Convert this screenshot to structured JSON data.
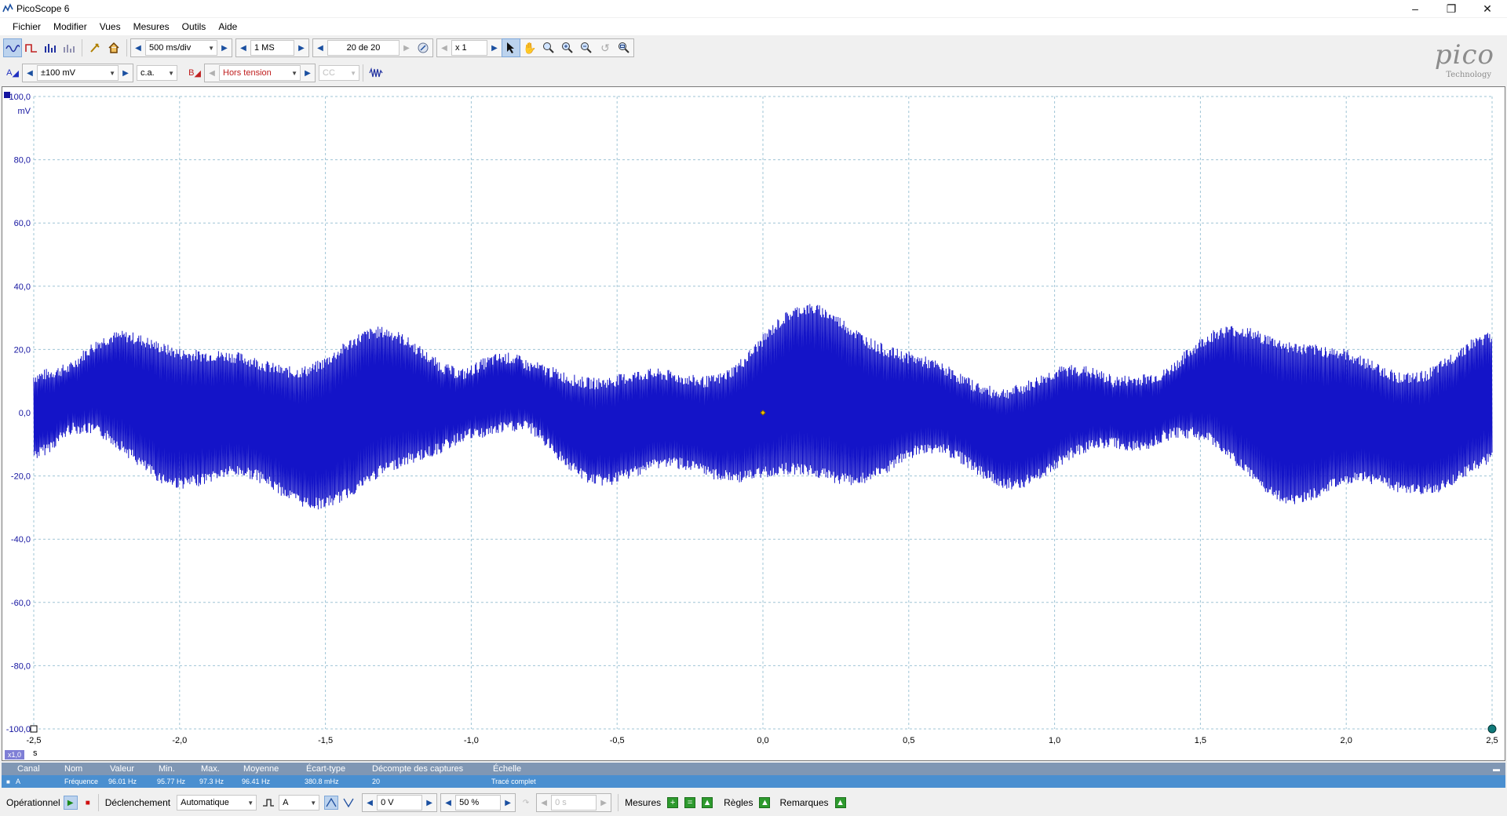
{
  "window": {
    "title": "PicoScope 6"
  },
  "menu": [
    "Fichier",
    "Modifier",
    "Vues",
    "Mesures",
    "Outils",
    "Aide"
  ],
  "toolbar": {
    "timebase": "500 ms/div",
    "samples": "1 MS",
    "capture": "20 de 20",
    "zoom": "x 1"
  },
  "channels": {
    "a_label": "A",
    "a_range": "±100 mV",
    "a_coupling": "c.a.",
    "b_label": "B",
    "b_range": "Hors tension",
    "b_coupling": "CC"
  },
  "logo": {
    "word": "pico",
    "sub": "Technology"
  },
  "axis": {
    "y_unit": "mV",
    "x_unit": "s",
    "x_zoom": "x1,0",
    "y_ticks": [
      "100,0",
      "80,0",
      "60,0",
      "40,0",
      "20,0",
      "0,0",
      "-20,0",
      "-40,0",
      "-60,0",
      "-80,0",
      "-100,0"
    ],
    "x_ticks": [
      "-2,5",
      "-2,0",
      "-1,5",
      "-1,0",
      "-0,5",
      "0,0",
      "0,5",
      "1,0",
      "1,5",
      "2,0",
      "2,5"
    ]
  },
  "measurements": {
    "headers": [
      "Canal",
      "Nom",
      "Valeur",
      "Min.",
      "Max.",
      "Moyenne",
      "Écart-type",
      "Décompte des captures",
      "Échelle"
    ],
    "rows": [
      [
        "A",
        "Fréquence",
        "96.01 Hz",
        "95.77 Hz",
        "97.3 Hz",
        "96.41 Hz",
        "380.8 mHz",
        "20",
        "Tracé complet"
      ]
    ]
  },
  "status": {
    "mode": "Opérationnel",
    "trigger_label": "Déclenchement",
    "trigger_mode": "Automatique",
    "trigger_channel": "A",
    "trigger_level": "0 V",
    "pretrigger": "50 %",
    "delay": "0 s",
    "measures": "Mesures",
    "rules": "Règles",
    "notes": "Remarques"
  },
  "colors": {
    "trace": "#1414c8",
    "grid": "#9fc4d6",
    "accent": "#4a8fd0"
  }
}
